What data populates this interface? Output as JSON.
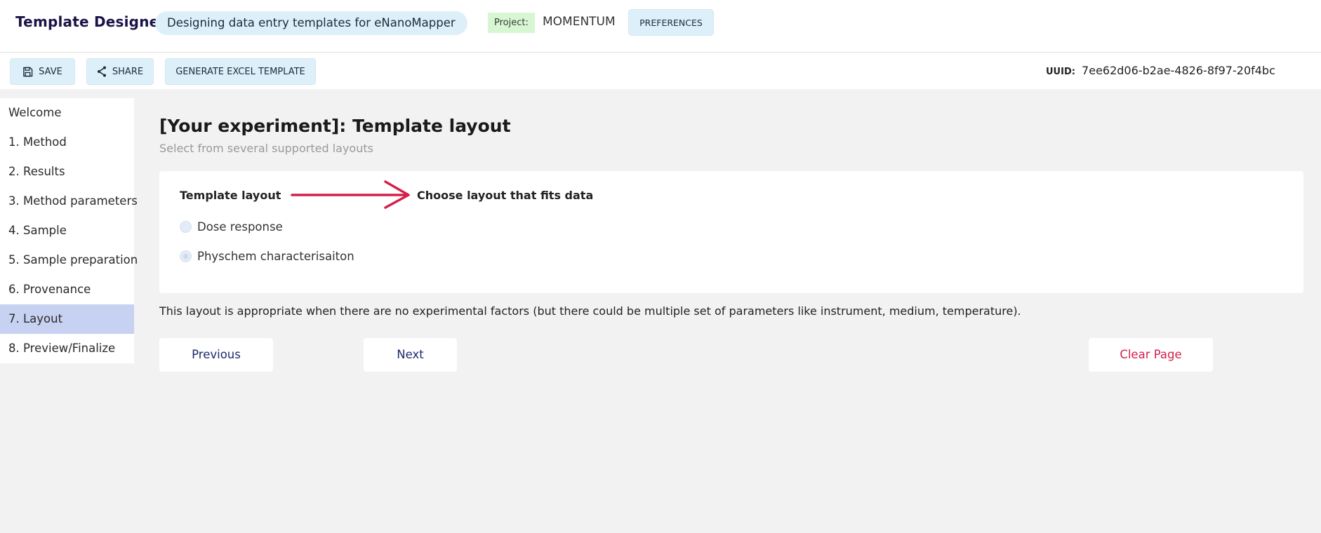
{
  "header": {
    "app_title": "Template Designer",
    "tagline": "Designing data entry templates for eNanoMapper",
    "project_label": "Project:",
    "project_name": "MOMENTUM",
    "preferences_label": "PREFERENCES"
  },
  "toolbar": {
    "save_label": "SAVE",
    "share_label": "SHARE",
    "excel_label": "GENERATE EXCEL TEMPLATE",
    "uuid_label": "UUID:",
    "uuid_value": "7ee62d06-b2ae-4826-8f97-20f4bc"
  },
  "sidebar": {
    "items": [
      {
        "label": "Welcome"
      },
      {
        "label": "1. Method"
      },
      {
        "label": "2. Results"
      },
      {
        "label": "3. Method parameters"
      },
      {
        "label": "4. Sample"
      },
      {
        "label": "5. Sample preparation"
      },
      {
        "label": "6. Provenance"
      },
      {
        "label": "7. Layout",
        "active": true
      },
      {
        "label": "8. Preview/Finalize"
      }
    ]
  },
  "main": {
    "title": "[Your experiment]: Template layout",
    "subtitle": "Select from several supported layouts",
    "field_label": "Template layout",
    "hint": "Choose layout that fits data",
    "options": [
      {
        "label": "Dose response",
        "selected": false
      },
      {
        "label": "Physchem characterisaiton",
        "selected": true
      }
    ],
    "description": "This layout is appropriate when there are no experimental factors (but there could be multiple set of parameters like instrument, medium, temperature).",
    "previous_label": "Previous",
    "next_label": "Next",
    "clear_label": "Clear Page"
  },
  "colors": {
    "accent_light": "#ddf0fa",
    "active_sidebar": "#c7d2f2",
    "arrow": "#d4204a",
    "nav_text": "#1a2a6c",
    "clear_text": "#d4204a",
    "project_tag": "#d6f7d2"
  },
  "icons": {
    "save": "save-icon",
    "share": "share-icon",
    "arrow": "arrow-right-icon"
  }
}
